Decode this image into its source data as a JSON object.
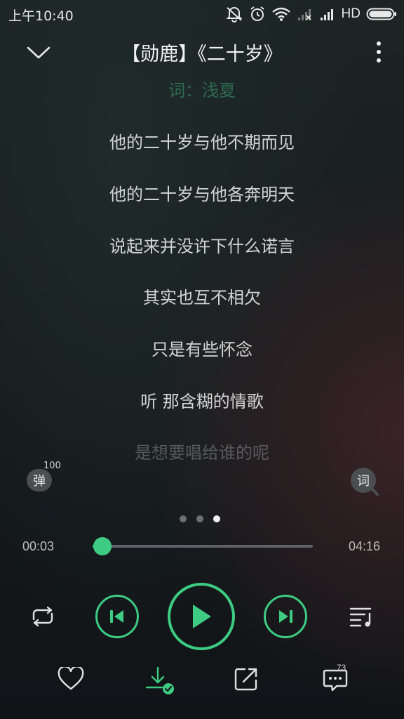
{
  "status_bar": {
    "time": "上午10:40",
    "network": "HD",
    "icons": [
      "mute-icon",
      "alarm-icon",
      "wifi-icon",
      "signal-weak-icon",
      "signal-icon",
      "battery-icon"
    ]
  },
  "header": {
    "title": "【勋鹿】《二十岁》",
    "back_icon": "chevron-down-icon",
    "more_icon": "more-vertical-icon"
  },
  "lyrics": {
    "credit": "词：浅夏",
    "lines": [
      "他的二十岁与他不期而见",
      "他的二十岁与他各奔明天",
      "说起来并没许下什么诺言",
      "其实也互不相欠",
      "只是有些怀念",
      "听 那含糊的情歌"
    ],
    "faded": "是想要唱给谁的呢"
  },
  "danmu": {
    "label": "弹",
    "count": "100"
  },
  "lyric_toggle": {
    "label": "词"
  },
  "pager": {
    "count": 3,
    "active": 2
  },
  "progress": {
    "current": "00:03",
    "total": "04:16",
    "fraction": 0.045
  },
  "comments": {
    "count": "73"
  },
  "colors": {
    "accent": "#3dcc82",
    "credit": "#2f6b50",
    "text": "#d4d4d4"
  }
}
